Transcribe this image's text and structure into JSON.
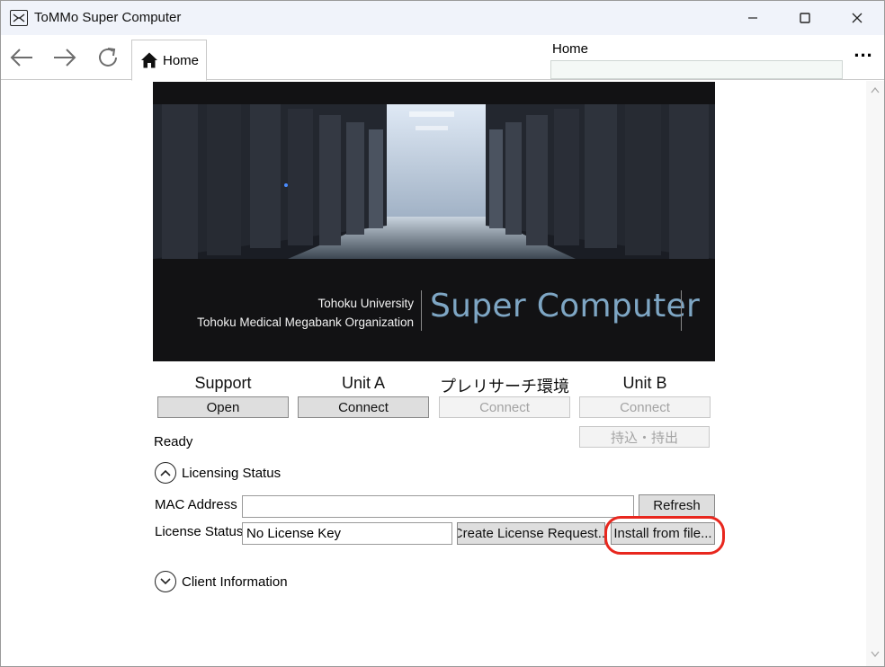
{
  "window": {
    "title": "ToMMo Super Computer",
    "accent": "#e8271e"
  },
  "nav": {
    "tab_label": "Home",
    "address_label": "Home",
    "address_value": "",
    "more_label": "..."
  },
  "banner": {
    "line1": "Tohoku University",
    "line2": "Tohoku Medical Megabank Organization",
    "title": "Super Computer",
    "title_color": "#7ea6c4"
  },
  "services": [
    {
      "title": "Support",
      "button": "Open",
      "enabled": true
    },
    {
      "title": "Unit A",
      "button": "Connect",
      "enabled": true
    },
    {
      "title": "プレリサーチ環境",
      "button": "Connect",
      "enabled": false
    },
    {
      "title": "Unit B",
      "button": "Connect",
      "enabled": false,
      "extra_button": "持込・持出"
    }
  ],
  "status": "Ready",
  "licensing": {
    "header": "Licensing Status",
    "expanded": true,
    "mac_label": "MAC Address",
    "mac_value": "",
    "refresh_label": "Refresh",
    "license_label": "License Status",
    "license_value": "No License Key",
    "create_request_label": "Create License Request...",
    "install_label": "Install from file..."
  },
  "client_info": {
    "header": "Client Information",
    "expanded": false
  }
}
